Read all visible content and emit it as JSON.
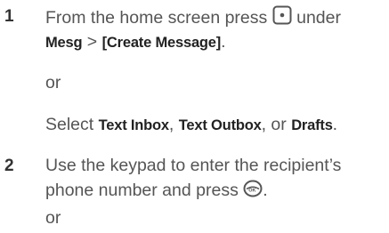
{
  "steps": [
    {
      "number": "1",
      "line1_pre": "From the home screen press",
      "line1_post": "under",
      "menu_mesg": "Mesg",
      "menu_sep": " > ",
      "menu_create": "[Create Message]",
      "menu_end": ".",
      "or_text": "or",
      "select_pre": "Select ",
      "opt1": "Text Inbox",
      "sep1": ", ",
      "opt2": "Text Outbox",
      "sep2": ", or ",
      "opt3": "Drafts",
      "select_end": ".",
      "center_key_icon": "center-select-key-icon"
    },
    {
      "number": "2",
      "line1": "Use the keypad to enter the recipient’s",
      "line2_pre": "phone number and press",
      "line2_end": ".",
      "or_text": "or",
      "ok_key_icon": "ok-key-icon"
    }
  ]
}
